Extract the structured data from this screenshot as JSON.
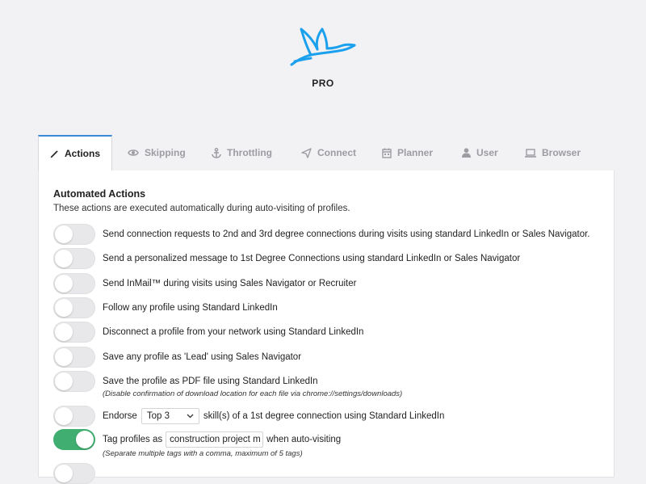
{
  "brand": {
    "badge": "PRO",
    "logo_icon": "bird-icon",
    "accent": "#1aa0ec"
  },
  "tabs": [
    {
      "label": "Actions",
      "icon": "magic-wand-icon",
      "active": true
    },
    {
      "label": "Skipping",
      "icon": "eye-icon"
    },
    {
      "label": "Throttling",
      "icon": "anchor-icon"
    },
    {
      "label": "Connect",
      "icon": "paper-plane-icon"
    },
    {
      "label": "Planner",
      "icon": "calendar-icon"
    },
    {
      "label": "User",
      "icon": "user-icon"
    },
    {
      "label": "Browser",
      "icon": "laptop-icon"
    }
  ],
  "section": {
    "title": "Automated Actions",
    "subtitle": "These actions are executed automatically during auto-visiting of profiles."
  },
  "actions": [
    {
      "label": "Send connection requests to 2nd and 3rd degree connections during visits using standard LinkedIn or Sales Navigator.",
      "enabled": false
    },
    {
      "label": "Send a personalized message to 1st Degree Connections using standard LinkedIn or Sales Navigator",
      "enabled": false
    },
    {
      "label": "Send InMail™ during visits using Sales Navigator or Recruiter",
      "enabled": false
    },
    {
      "label": "Follow any profile using Standard LinkedIn",
      "enabled": false
    },
    {
      "label": "Disconnect a profile from your network using Standard LinkedIn",
      "enabled": false
    },
    {
      "label": "Save any profile as 'Lead' using Sales Navigator",
      "enabled": false
    },
    {
      "label": "Save the profile as PDF file using Standard LinkedIn",
      "enabled": false,
      "note": "(Disable confirmation of download location for each file via chrome://settings/downloads)"
    }
  ],
  "endorse": {
    "prefix": "Endorse",
    "select_value": "Top 3",
    "suffix": "skill(s) of a 1st degree connection using Standard LinkedIn",
    "enabled": false
  },
  "tag": {
    "prefix": "Tag profiles as",
    "input_value": "construction project m",
    "suffix": "when auto-visiting",
    "note": "(Separate multiple tags with a comma, maximum of 5 tags)",
    "enabled": true
  },
  "colors": {
    "toggle_on": "#3fae70",
    "tab_active_border": "#3a8ad8"
  }
}
